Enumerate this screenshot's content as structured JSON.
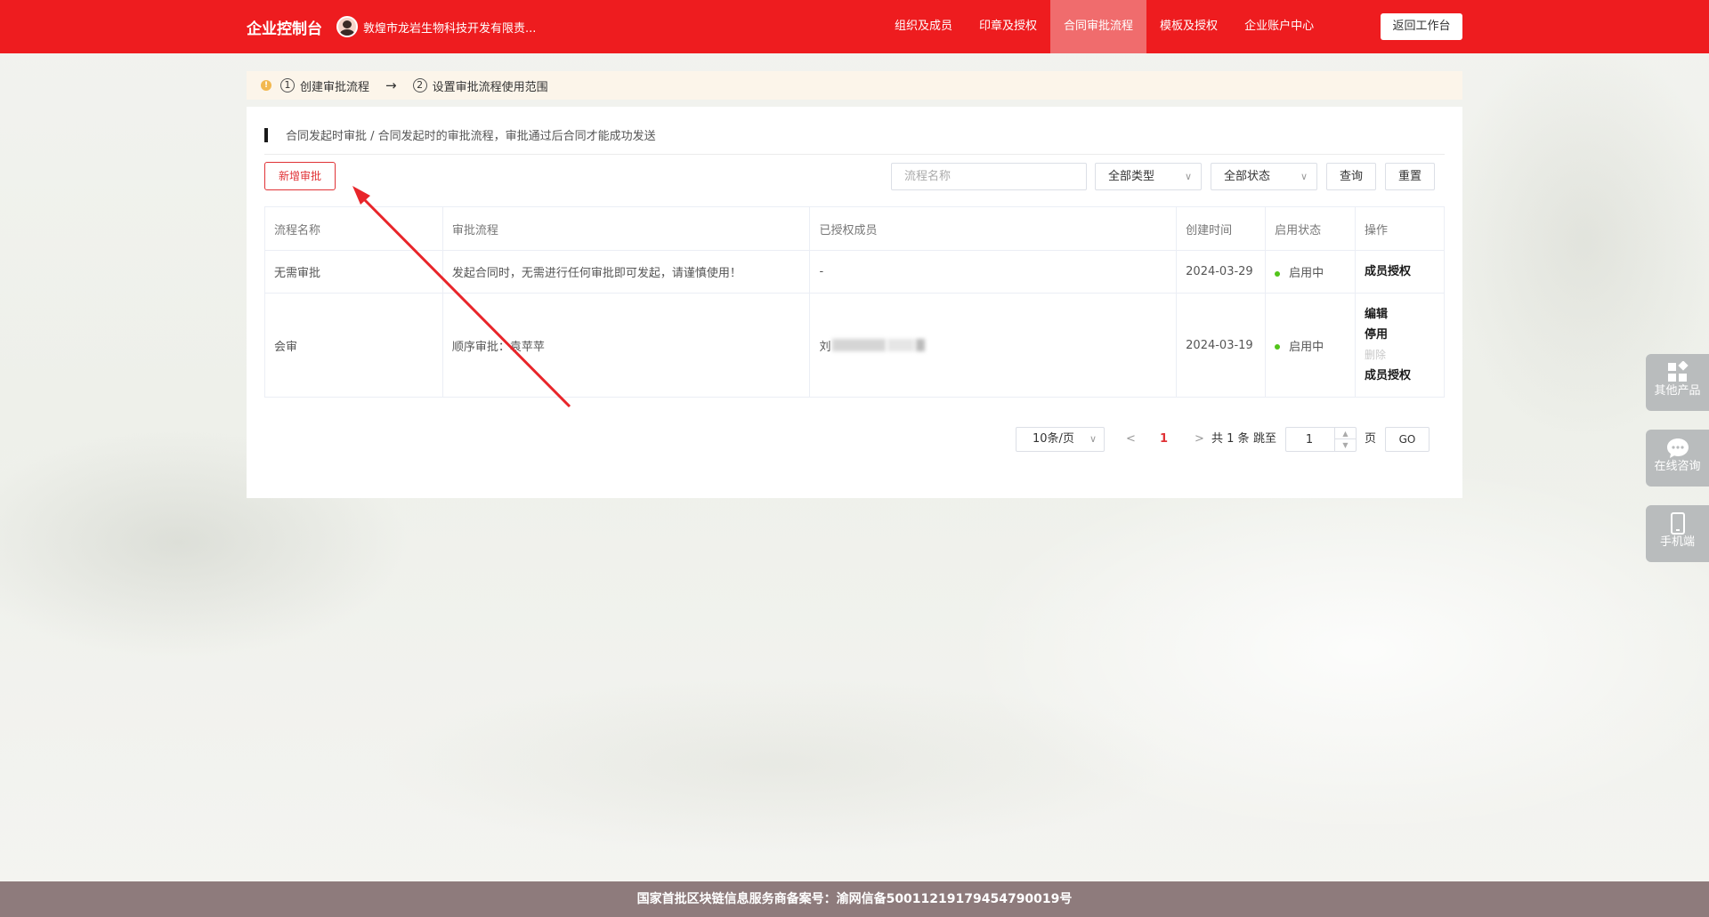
{
  "header": {
    "brand": "企业控制台",
    "company": "敦煌市龙岩生物科技开发有限责...",
    "nav": [
      "组织及成员",
      "印章及授权",
      "合同审批流程",
      "模板及授权",
      "企业账户中心"
    ],
    "active_nav_index": 2,
    "back_button": "返回工作台",
    "color": "#ee1c1f"
  },
  "steps": {
    "warn": "!",
    "items": [
      {
        "num": "1",
        "label": "创建审批流程"
      },
      {
        "num": "2",
        "label": "设置审批流程使用范围"
      }
    ],
    "arrow": "→"
  },
  "page": {
    "description": "合同发起时审批 / 合同发起时的审批流程，审批通过后合同才能成功发送",
    "add_button": "新增审批"
  },
  "filters": {
    "search_placeholder": "流程名称",
    "type_select": "全部类型",
    "status_select": "全部状态",
    "query_button": "查询",
    "reset_button": "重置"
  },
  "table": {
    "columns": [
      "流程名称",
      "审批流程",
      "已授权成员",
      "创建时间",
      "启用状态",
      "操作"
    ],
    "rows": [
      {
        "name": "无需审批",
        "flow": "发起合同时，无需进行任何审批即可发起，请谨慎使用！",
        "members": "-",
        "created": "2024-03-29",
        "status": "启用中",
        "actions": [
          "成员授权"
        ]
      },
      {
        "name": "会审",
        "flow": "顺序审批：袁苹苹",
        "members": "刘",
        "created": "2024-03-19",
        "status": "启用中",
        "actions": [
          "编辑",
          "停用",
          "删除",
          "成员授权"
        ]
      }
    ]
  },
  "pagination": {
    "page_size": "10条/页",
    "current_page": "1",
    "total_text": "共 1 条",
    "jump_text": "跳至",
    "jump_value": "1",
    "page_unit": "页",
    "go_button": "GO"
  },
  "float_panel": [
    {
      "label": "其他产品",
      "icon": "apps-icon"
    },
    {
      "label": "在线咨询",
      "icon": "chat-icon"
    },
    {
      "label": "手机端",
      "icon": "mobile-icon"
    }
  ],
  "footer": {
    "text": "国家首批区块链信息服务商备案号：渝网信备50011219179454790019号"
  }
}
